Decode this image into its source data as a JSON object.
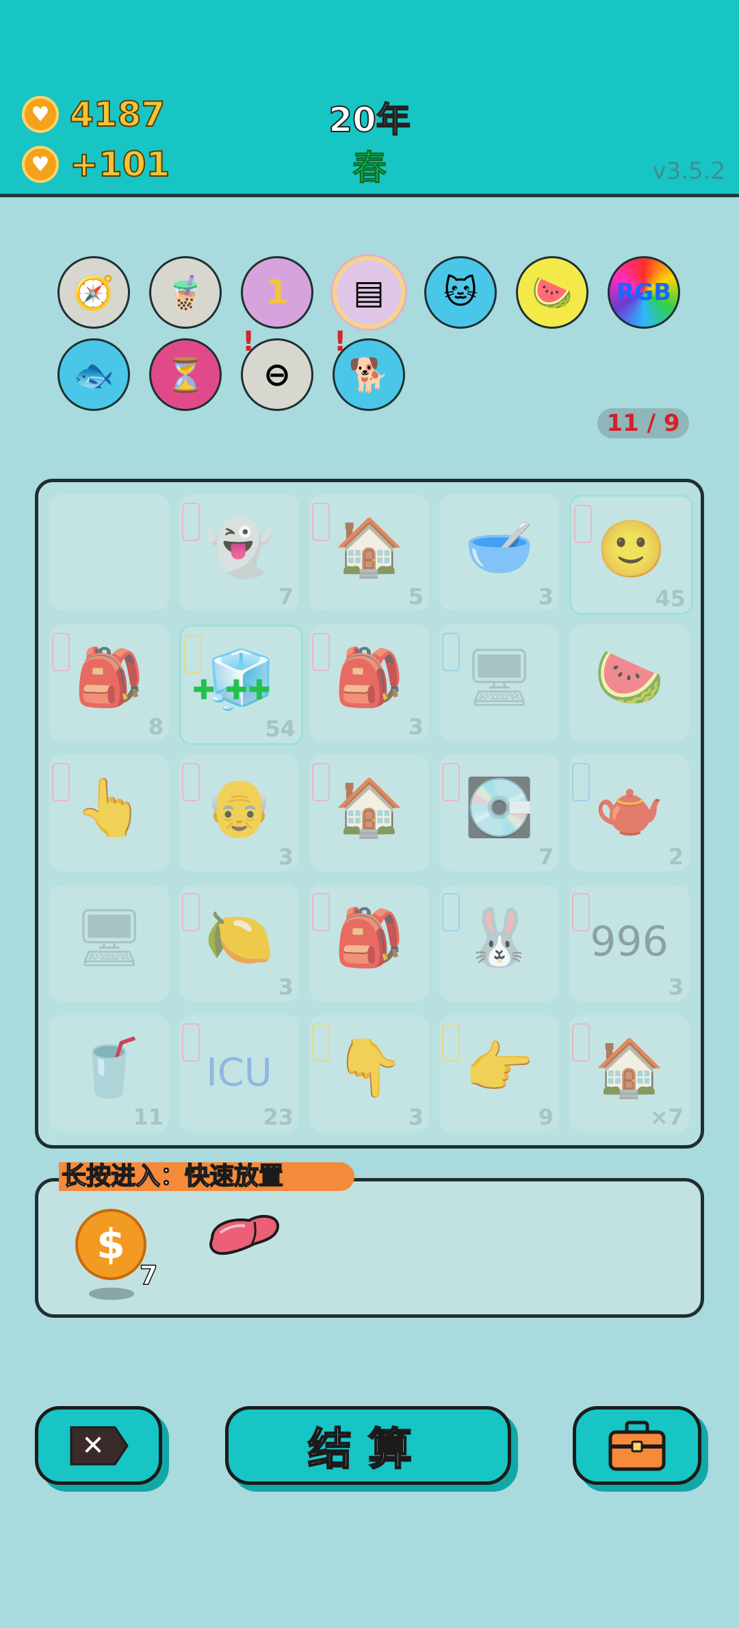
{
  "header": {
    "coins": "4187",
    "income": "+101",
    "year": "20年",
    "season": "春",
    "version": "v3.5.2"
  },
  "skills": [
    {
      "name": "compass-icon",
      "bg": "#d7d7cf",
      "glyph": "🧭",
      "selected": false
    },
    {
      "name": "bubble-tea-icon",
      "bg": "#d7d7cf",
      "glyph": "🧋",
      "selected": false
    },
    {
      "name": "girl-coin-icon",
      "bg": "#d6a3dd",
      "glyph": "1",
      "selected": false
    },
    {
      "name": "skirt-icon",
      "bg": "#dfc6e6",
      "glyph": "▤",
      "selected": true
    },
    {
      "name": "cats-icon",
      "bg": "#4ac6e8",
      "glyph": "🐱",
      "selected": false
    },
    {
      "name": "fruit-bowl-icon",
      "bg": "#f3ea4a",
      "glyph": "🍉",
      "selected": false
    },
    {
      "name": "rgb-icon",
      "bg": "#6b3ad1",
      "glyph": "RGB",
      "selected": false
    },
    {
      "name": "fish-tank-icon",
      "bg": "#4ac6e8",
      "glyph": "🐟",
      "selected": false
    },
    {
      "name": "hourglass-icon",
      "bg": "#e14a8a",
      "glyph": "⏳",
      "selected": false
    },
    {
      "name": "no-entry-icon",
      "bg": "#d7d7cf",
      "glyph": "⊖",
      "selected": false,
      "alert": true
    },
    {
      "name": "dog-icon",
      "bg": "#4ac6e8",
      "glyph": "🐕",
      "selected": false,
      "alert": true
    }
  ],
  "counter": "11 / 9",
  "board": [
    [
      {
        "name": "empty",
        "tag": "",
        "glyph": "",
        "count": ""
      },
      {
        "name": "ghost",
        "tag": "pink",
        "glyph": "👻",
        "count": "7"
      },
      {
        "name": "house",
        "tag": "pink",
        "glyph": "🏠",
        "count": "5"
      },
      {
        "name": "bowl",
        "tag": "",
        "glyph": "🥣",
        "count": "3"
      },
      {
        "name": "face",
        "tag": "pink",
        "glyph": "🙂",
        "count": "45",
        "hl": true
      }
    ],
    [
      {
        "name": "bunny-bag",
        "tag": "pink",
        "glyph": "🎒",
        "count": "8"
      },
      {
        "name": "fridge",
        "tag": "yellow",
        "glyph": "🧊",
        "count": "54",
        "hl": true
      },
      {
        "name": "bunny-bag",
        "tag": "pink",
        "glyph": "🎒",
        "count": "3"
      },
      {
        "name": "pc-tower",
        "tag": "blue",
        "glyph": "🖥",
        "count": ""
      },
      {
        "name": "watermelon",
        "tag": "",
        "glyph": "🍉",
        "count": ""
      }
    ],
    [
      {
        "name": "pointing-hand",
        "tag": "pink",
        "glyph": "👆",
        "count": ""
      },
      {
        "name": "old-man",
        "tag": "pink",
        "glyph": "👴",
        "count": "3"
      },
      {
        "name": "house-sign",
        "tag": "pink",
        "glyph": "🏠",
        "count": ""
      },
      {
        "name": "gpu",
        "tag": "pink",
        "glyph": "💽",
        "count": "7"
      },
      {
        "name": "teapot",
        "tag": "blue",
        "glyph": "🫖",
        "count": "2"
      }
    ],
    [
      {
        "name": "monitor",
        "tag": "",
        "glyph": "🖥",
        "count": ""
      },
      {
        "name": "lemon-face",
        "tag": "pink",
        "glyph": "🍋",
        "count": "3"
      },
      {
        "name": "bunny-bag",
        "tag": "pink",
        "glyph": "🎒",
        "count": ""
      },
      {
        "name": "rabbit",
        "tag": "blue",
        "glyph": "🐰",
        "count": ""
      },
      {
        "name": "996",
        "tag": "pink",
        "glyph": "996",
        "count": "3"
      }
    ],
    [
      {
        "name": "drink-cup",
        "tag": "",
        "glyph": "🥤",
        "count": "11"
      },
      {
        "name": "icu",
        "tag": "pink",
        "glyph": "ICU",
        "count": "23"
      },
      {
        "name": "yellow-hand",
        "tag": "yellow",
        "glyph": "👇",
        "count": "3"
      },
      {
        "name": "pointing-right",
        "tag": "yellow",
        "glyph": "👉",
        "count": "9"
      },
      {
        "name": "house",
        "tag": "pink",
        "glyph": "🏠",
        "count": "×7"
      }
    ]
  ],
  "tray": {
    "label": "长按进入：快速放置",
    "dollar_glyph": "$",
    "dollar_count": "7"
  },
  "buttons": {
    "close_glyph": "✕",
    "settle_label": "结算",
    "bag_glyph": "💼"
  },
  "colors": {
    "header_bg": "#17c5c5",
    "page_bg": "#a9dadd",
    "coin": "#f6a11a",
    "season_green": "#19d24f",
    "alert_red": "#d8232a"
  }
}
